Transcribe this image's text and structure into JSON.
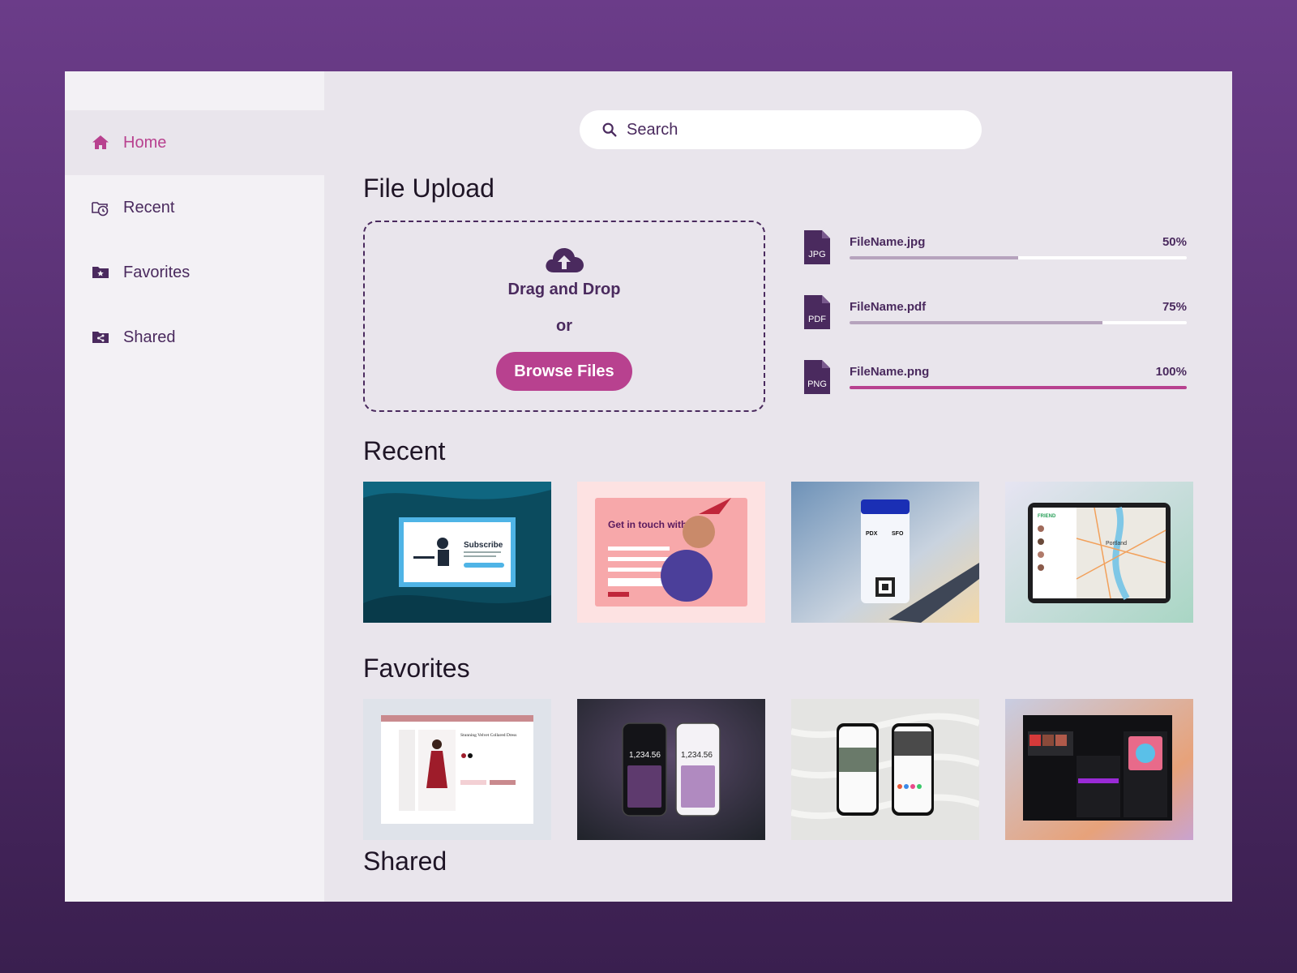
{
  "sidebar": {
    "items": [
      {
        "label": "Home",
        "icon": "home-icon",
        "active": true
      },
      {
        "label": "Recent",
        "icon": "recent-folder-icon"
      },
      {
        "label": "Favorites",
        "icon": "favorite-folder-icon"
      },
      {
        "label": "Shared",
        "icon": "shared-folder-icon"
      }
    ]
  },
  "search": {
    "placeholder": "Search",
    "icon": "search-icon"
  },
  "upload": {
    "title": "File Upload",
    "drag_drop": "Drag and Drop",
    "or": "or",
    "browse_label": "Browse Files",
    "icon": "cloud-upload-icon"
  },
  "files": [
    {
      "type": "JPG",
      "name": "FileName.jpg",
      "percent_label": "50%",
      "progress": 0.5
    },
    {
      "type": "PDF",
      "name": "FileName.pdf",
      "percent_label": "75%",
      "progress": 0.75
    },
    {
      "type": "PNG",
      "name": "FileName.png",
      "percent_label": "100%",
      "progress": 1.0
    }
  ],
  "recent": {
    "title": "Recent",
    "thumb_texts": {
      "subscribe": "Subscribe",
      "contact": "Get in touch with us!",
      "origin": "PDX",
      "destination": "SFO",
      "friend": "FRIEND",
      "city": "Portland"
    }
  },
  "favorites": {
    "title": "Favorites",
    "thumb_texts": {
      "product": "Stunning Velvet Collared Dress",
      "calc_a": "1,234.56",
      "calc_b": "1,234.56"
    }
  },
  "shared": {
    "title": "Shared"
  },
  "colors": {
    "accent": "#b8418f",
    "primary_text": "#4a2a5e",
    "background": "#e9e5ec"
  }
}
